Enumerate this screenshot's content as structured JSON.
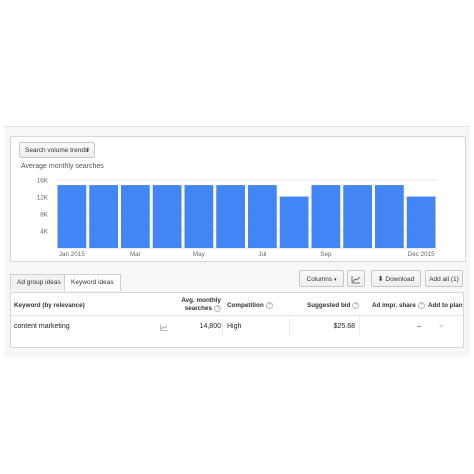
{
  "toolbar": {
    "trend_select": "Search volume trends",
    "columns_label": "Columns",
    "download_label": "Download",
    "add_all_label": "Add all (1)"
  },
  "tabs": [
    {
      "label": "Ad group ideas",
      "active": false
    },
    {
      "label": "Keyword ideas",
      "active": true
    }
  ],
  "table": {
    "headers": {
      "keyword": "Keyword (by relevance)",
      "avg_line1": "Avg. monthly",
      "avg_line2": "searches",
      "competition": "Competition",
      "bid": "Suggested bid",
      "impr": "Ad impr. share",
      "add": "Add to plan"
    },
    "rows": [
      {
        "keyword": "content marketing",
        "avg": "14,800",
        "competition": "High",
        "bid": "$25.68",
        "impr": "–",
        "add": "»"
      }
    ]
  },
  "colors": {
    "bar": "#4285f4",
    "grid": "#e5e5e5",
    "axis_text": "#666666"
  },
  "chart_data": {
    "type": "bar",
    "title": "Average monthly searches",
    "categories": [
      "Jan 2015",
      "Feb 2015",
      "Mar 2015",
      "Apr 2015",
      "May 2015",
      "Jun 2015",
      "Jul 2015",
      "Aug 2015",
      "Sep 2015",
      "Oct 2015",
      "Nov 2015",
      "Dec 2015"
    ],
    "x_tick_labels": [
      "Jan 2015",
      "",
      "Mar",
      "",
      "May",
      "",
      "Jul",
      "",
      "Sep",
      "",
      "",
      "Dec 2015"
    ],
    "values": [
      14800,
      14800,
      14800,
      14800,
      14800,
      14800,
      14800,
      12100,
      14800,
      14800,
      14800,
      12100
    ],
    "y_ticks": [
      4000,
      8000,
      12000,
      16000
    ],
    "y_tick_labels": [
      "4K",
      "8K",
      "12K",
      "16K"
    ],
    "ylim": [
      0,
      16000
    ],
    "grid": true
  }
}
